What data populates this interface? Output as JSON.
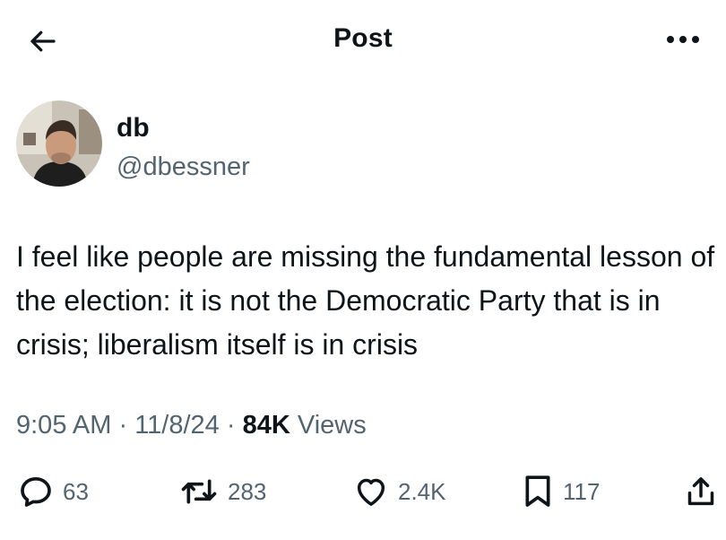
{
  "header": {
    "title": "Post",
    "back_icon": "arrow-left-icon",
    "more_icon": "more-horizontal-icon"
  },
  "author": {
    "name": "db",
    "handle": "@dbessner"
  },
  "tweet": {
    "text": "I feel like people are missing the fundamental lesson of the election: it is not the Democratic Party that is in crisis; liberalism itself is in crisis"
  },
  "meta": {
    "time": "9:05 AM",
    "separator": "·",
    "date": "11/8/24",
    "views_count": "84K",
    "views_label": "Views"
  },
  "actions": {
    "replies": "63",
    "reposts": "283",
    "likes": "2.4K",
    "bookmarks": "117"
  },
  "colors": {
    "text_primary": "#0f1419",
    "text_secondary": "#536471",
    "background": "#ffffff"
  }
}
